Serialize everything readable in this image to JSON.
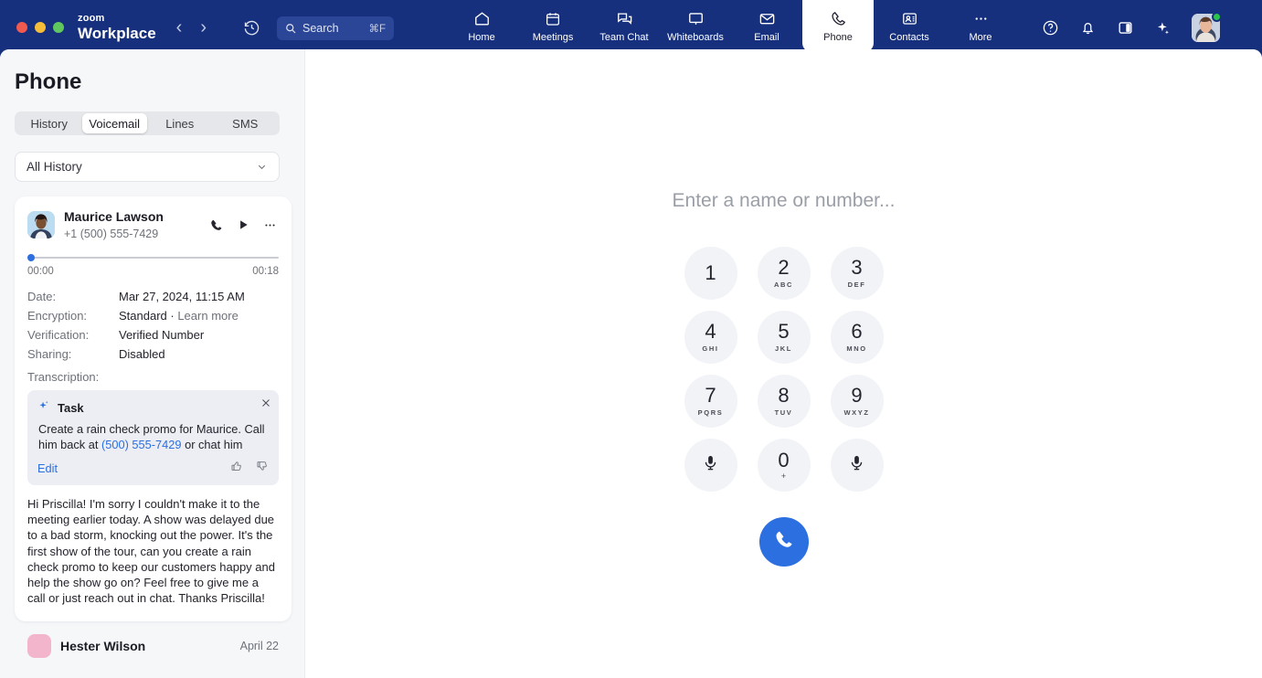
{
  "window": {
    "traffic_lights": [
      "close",
      "minimize",
      "maximize"
    ],
    "brand_top": "zoom",
    "brand_bottom": "Workplace"
  },
  "search": {
    "placeholder": "Search",
    "shortcut": "⌘F"
  },
  "nav_tabs": [
    {
      "label": "Home",
      "icon": "home-icon",
      "active": false
    },
    {
      "label": "Meetings",
      "icon": "calendar-icon",
      "active": false
    },
    {
      "label": "Team Chat",
      "icon": "chat-bubbles-icon",
      "active": false
    },
    {
      "label": "Whiteboards",
      "icon": "whiteboard-icon",
      "active": false
    },
    {
      "label": "Email",
      "icon": "envelope-icon",
      "active": false
    },
    {
      "label": "Phone",
      "icon": "phone-handset-icon",
      "active": true
    },
    {
      "label": "Contacts",
      "icon": "contacts-card-icon",
      "active": false
    },
    {
      "label": "More",
      "icon": "ellipsis-icon",
      "active": false
    }
  ],
  "right_tools": [
    {
      "name": "help-icon"
    },
    {
      "name": "bell-icon"
    },
    {
      "name": "side-panel-icon"
    },
    {
      "name": "ai-sparkle-icon"
    }
  ],
  "sidebar": {
    "title": "Phone",
    "segments": [
      {
        "label": "History",
        "active": false
      },
      {
        "label": "Voicemail",
        "active": true
      },
      {
        "label": "Lines",
        "active": false
      },
      {
        "label": "SMS",
        "active": false
      }
    ],
    "filter": {
      "value": "All History",
      "icon": "chevron-down-icon"
    }
  },
  "voicemail": {
    "contact_name": "Maurice Lawson",
    "contact_number": "+1 (500) 555-7429",
    "actions": [
      {
        "name": "call-back-icon"
      },
      {
        "name": "play-icon"
      },
      {
        "name": "more-options-icon"
      }
    ],
    "player": {
      "current_time": "00:00",
      "total_time": "00:18",
      "progress_percent": 0
    },
    "meta": [
      {
        "key": "Date:",
        "value": "Mar 27, 2024, 11:15 AM"
      },
      {
        "key": "Encryption:",
        "value": "Standard",
        "suffix": " · ",
        "link": "Learn more"
      },
      {
        "key": "Verification:",
        "value": "Verified Number"
      },
      {
        "key": "Sharing:",
        "value": "Disabled"
      }
    ],
    "transcription_label": "Transcription:",
    "task_card": {
      "icon": "ai-sparkle-icon",
      "title": "Task",
      "text_before": "Create a rain check promo for Maurice. Call him back at ",
      "phone_link": "(500) 555-7429",
      "text_after": " or chat him",
      "edit_label": "Edit",
      "thumbs_up": "thumbs-up-icon",
      "thumbs_down": "thumbs-down-icon",
      "close": "close-icon"
    },
    "transcript": "Hi Priscilla! I'm sorry I couldn't make it to the meeting earlier today. A show was delayed due to a bad storm, knocking out the power. It's the first show of the tour, can you create a rain check promo to keep our customers happy and help the show go on? Feel free to give me a call or just reach out in chat. Thanks Priscilla!"
  },
  "next_voicemail": {
    "name": "Hester Wilson",
    "date": "April 22"
  },
  "dialer": {
    "placeholder": "Enter a name or number...",
    "keys": [
      {
        "digit": "1",
        "letters": ""
      },
      {
        "digit": "2",
        "letters": "ABC"
      },
      {
        "digit": "3",
        "letters": "DEF"
      },
      {
        "digit": "4",
        "letters": "GHI"
      },
      {
        "digit": "5",
        "letters": "JKL"
      },
      {
        "digit": "6",
        "letters": "MNO"
      },
      {
        "digit": "7",
        "letters": "PQRS"
      },
      {
        "digit": "8",
        "letters": "TUV"
      },
      {
        "digit": "9",
        "letters": "WXYZ"
      }
    ],
    "star_key": {
      "icon": "microphone-icon"
    },
    "zero_key": {
      "digit": "0",
      "sub": "+"
    },
    "hash_key": {
      "icon": "microphone-icon"
    },
    "call_button": {
      "icon": "phone-handset-icon"
    }
  },
  "colors": {
    "header_blue": "#16307e",
    "accent_blue": "#2b6fe0",
    "sidebar_bg": "#f6f7f9",
    "key_bg": "#f1f3f6",
    "presence_green": "#2bc24a"
  }
}
